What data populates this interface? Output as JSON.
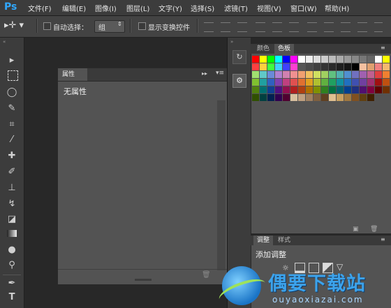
{
  "app": {
    "logo": "Ps"
  },
  "menu": [
    "文件(F)",
    "编辑(E)",
    "图像(I)",
    "图层(L)",
    "文字(Y)",
    "选择(S)",
    "滤镜(T)",
    "视图(V)",
    "窗口(W)",
    "帮助(H)"
  ],
  "options": {
    "auto_select_label": "自动选择：",
    "group_value": "组",
    "show_transform_label": "显示变换控件"
  },
  "properties_panel": {
    "tab": "属性",
    "empty_text": "无属性"
  },
  "swatches_panel": {
    "tabs": [
      "颜色",
      "色板"
    ],
    "active_tab": "色板",
    "colors": [
      "#ff0000",
      "#ffff00",
      "#00ff00",
      "#00ffff",
      "#0000ff",
      "#ff00ff",
      "#ffffff",
      "#eeeeee",
      "#dddddd",
      "#cccccc",
      "#bbbbbb",
      "#aaaaaa",
      "#999999",
      "#888888",
      "#777777",
      "#666666",
      "#ffffff",
      "#ffff00",
      "#ff4040",
      "#ffd040",
      "#40ff40",
      "#40d0ff",
      "#4040ff",
      "#ff40d0",
      "#555555",
      "#4a4a4a",
      "#404040",
      "#333333",
      "#2a2a2a",
      "#1f1f1f",
      "#151515",
      "#000000",
      "#f5c0a0",
      "#e0a070",
      "#f08080",
      "#f4b870",
      "#a0e070",
      "#60c8c8",
      "#6a8ad8",
      "#b080d0",
      "#d080b0",
      "#f09090",
      "#f0a070",
      "#f0c060",
      "#d0e060",
      "#a0d060",
      "#60c080",
      "#50b0b0",
      "#5090d0",
      "#7070c0",
      "#a060b0",
      "#c06090",
      "#e04040",
      "#f08030",
      "#80c030",
      "#20a0a0",
      "#3060c0",
      "#8040b0",
      "#c04080",
      "#e05050",
      "#e07030",
      "#e0a020",
      "#b0c030",
      "#60b040",
      "#20a060",
      "#1090a0",
      "#2070c0",
      "#4050b0",
      "#7040a0",
      "#a03070",
      "#a01010",
      "#c05010",
      "#508010",
      "#007070",
      "#104090",
      "#501080",
      "#901050",
      "#b02020",
      "#b04010",
      "#b07000",
      "#809000",
      "#308020",
      "#007040",
      "#006070",
      "#004090",
      "#203080",
      "#501070",
      "#800040",
      "#600000",
      "#703000",
      "#305000",
      "#004040",
      "#002050",
      "#300050",
      "#500030",
      "#d8c0a0",
      "#c0a080",
      "#a08060",
      "#806040",
      "#604020",
      "#e0c090",
      "#c8a060",
      "#a07840",
      "#805020",
      "#604010",
      "#402000"
    ]
  },
  "adjustments_panel": {
    "tabs": [
      "调整",
      "样式"
    ],
    "active_tab": "调整",
    "title": "添加调整"
  },
  "watermark": {
    "text": "偶要下载站",
    "url": "ouyaoxiazai.com"
  }
}
